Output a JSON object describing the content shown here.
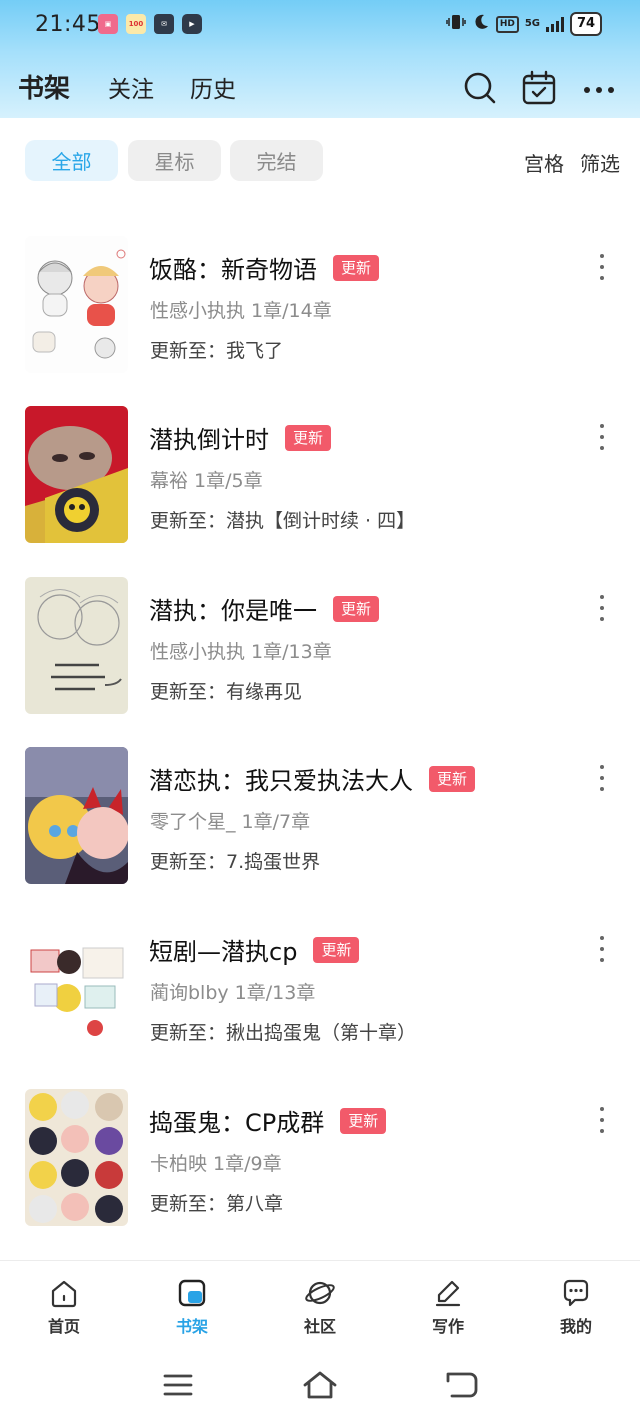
{
  "status_bar": {
    "time": "21:45",
    "network": "5G",
    "hd": "HD",
    "battery": "74"
  },
  "header": {
    "tabs": [
      {
        "label": "书架",
        "active": true
      },
      {
        "label": "关注",
        "active": false
      },
      {
        "label": "历史",
        "active": false
      }
    ],
    "icons": [
      "search-icon",
      "calendar-check-icon",
      "more-horizontal-icon"
    ]
  },
  "filters": {
    "chips": [
      {
        "label": "全部",
        "active": true
      },
      {
        "label": "星标",
        "active": false
      },
      {
        "label": "完结",
        "active": false
      }
    ],
    "grid_label": "宫格",
    "filter_label": "筛选"
  },
  "books": [
    {
      "title": "饭酪：新奇物语",
      "badge": "更新",
      "meta": "性感小执执  1章/14章",
      "update": "更新至：我飞了"
    },
    {
      "title": "潜执倒计时",
      "badge": "更新",
      "meta": "幕裕  1章/5章",
      "update": "更新至：潜执【倒计时续 · 四】"
    },
    {
      "title": "潜执：你是唯一",
      "badge": "更新",
      "meta": "性感小执执  1章/13章",
      "update": "更新至：有缘再见"
    },
    {
      "title": "潜恋执：我只爱执法大人",
      "badge": "更新",
      "meta": "零了个星_  1章/7章",
      "update": "更新至：7.捣蛋世界"
    },
    {
      "title": "短剧—潜执cp",
      "badge": "更新",
      "meta": "蔺询blby  1章/13章",
      "update": "更新至：揪出捣蛋鬼（第十章）"
    },
    {
      "title": "捣蛋鬼：CP成群",
      "badge": "更新",
      "meta": "卡柏映  1章/9章",
      "update": "更新至：第八章"
    }
  ],
  "bottom_nav": [
    {
      "label": "首页",
      "icon": "home-icon",
      "active": false
    },
    {
      "label": "书架",
      "icon": "bookshelf-icon",
      "active": true
    },
    {
      "label": "社区",
      "icon": "planet-icon",
      "active": false
    },
    {
      "label": "写作",
      "icon": "pen-icon",
      "active": false
    },
    {
      "label": "我的",
      "icon": "chat-bubble-icon",
      "active": false
    }
  ],
  "colors": {
    "accent": "#29a3e6",
    "badge": "#f25a6a",
    "header_gradient_top": "#74cdf6"
  }
}
